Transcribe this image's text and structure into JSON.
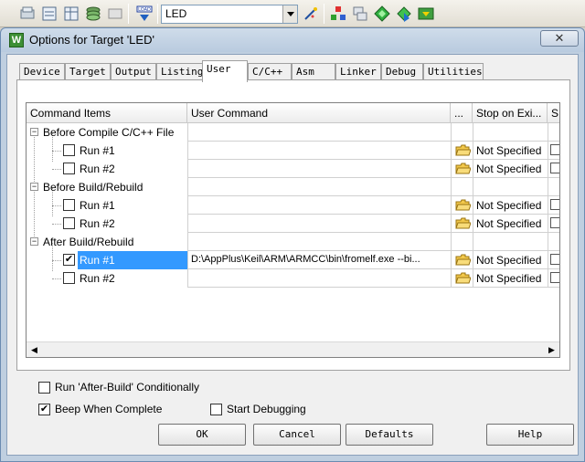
{
  "toolbar": {
    "target_combo_value": "LED"
  },
  "dialog": {
    "title": "Options for Target 'LED'",
    "close_glyph": "✕",
    "title_icon_letter": "W"
  },
  "tabs": [
    {
      "label": "Device"
    },
    {
      "label": "Target"
    },
    {
      "label": "Output"
    },
    {
      "label": "Listing"
    },
    {
      "label": "User"
    },
    {
      "label": "C/C++"
    },
    {
      "label": "Asm"
    },
    {
      "label": "Linker"
    },
    {
      "label": "Debug"
    },
    {
      "label": "Utilities"
    }
  ],
  "active_tab": "User",
  "grid": {
    "headers": {
      "items": "Command Items",
      "command": "User Command",
      "browse": "...",
      "stop": "Stop on Exi...",
      "s": "S..."
    },
    "groups": [
      {
        "label": "Before Compile C/C++ File",
        "expander": "−",
        "runs": [
          {
            "label": "Run #1",
            "checked": false,
            "command": "",
            "stop": "Not Specified"
          },
          {
            "label": "Run #2",
            "checked": false,
            "command": "",
            "stop": "Not Specified"
          }
        ]
      },
      {
        "label": "Before Build/Rebuild",
        "expander": "−",
        "runs": [
          {
            "label": "Run #1",
            "checked": false,
            "command": "",
            "stop": "Not Specified"
          },
          {
            "label": "Run #2",
            "checked": false,
            "command": "",
            "stop": "Not Specified"
          }
        ]
      },
      {
        "label": "After Build/Rebuild",
        "expander": "−",
        "runs": [
          {
            "label": "Run #1",
            "checked": true,
            "selected": true,
            "command": "D:\\AppPlus\\Keil\\ARM\\ARMCC\\bin\\fromelf.exe --bi...",
            "stop": "Not Specified"
          },
          {
            "label": "Run #2",
            "checked": false,
            "command": "",
            "stop": "Not Specified"
          }
        ]
      }
    ],
    "scroll_left": "◀",
    "scroll_right": "▶"
  },
  "options": {
    "run_after_build": {
      "label": "Run 'After-Build' Conditionally",
      "checked": false
    },
    "beep": {
      "label": "Beep When Complete",
      "checked": true
    },
    "start_debugging": {
      "label": "Start Debugging",
      "checked": false
    }
  },
  "buttons": {
    "ok": "OK",
    "cancel": "Cancel",
    "defaults": "Defaults",
    "help": "Help"
  },
  "check_glyph": "✔",
  "colors": {
    "selection": "#3399ff",
    "title_bg": "#bfcfe0"
  }
}
